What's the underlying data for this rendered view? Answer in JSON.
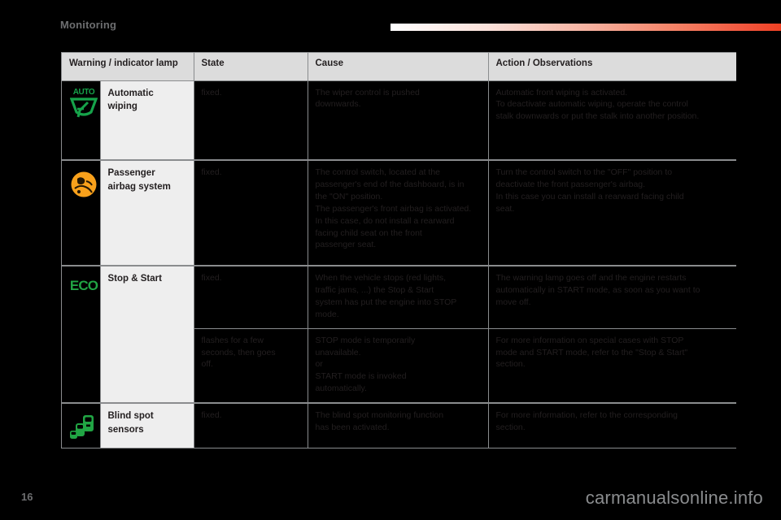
{
  "header": {
    "chapter": "Monitoring",
    "accent_color": "#ef4123"
  },
  "table": {
    "columns": [
      "Warning / indicator lamp",
      "State",
      "Cause",
      "Action / Observations"
    ],
    "rows": [
      {
        "icon": "auto-wiping-icon",
        "icon_text": "AUTO",
        "icon_color": "#16a34a",
        "label": "Automatic\nwiping",
        "state": "fixed.",
        "cause": "The wiper control is pushed\ndownwards.",
        "action": "Automatic front wiping is activated.\nTo deactivate automatic wiping, operate the control\nstalk downwards or put the stalk into another position."
      },
      {
        "icon": "passenger-airbag-icon",
        "icon_text": "",
        "icon_color": "#f9a11b",
        "label": "Passenger\nairbag system",
        "state": "fixed.",
        "cause": "The control switch, located at the\npassenger's end of the dashboard, is in\nthe \"ON\" position.\nThe passenger's front airbag is activated.\nIn this case, do not install a rearward\nfacing child seat on the front\npassenger seat.",
        "action": "Turn the control switch to the \"OFF\" position to\ndeactivate the front passenger's airbag.\nIn this case you can install a rearward facing child\nseat."
      },
      {
        "icon": "eco-icon",
        "icon_text": "ECO",
        "icon_color": "#21a544",
        "label": "Stop & Start",
        "state": "fixed.",
        "cause": "When the vehicle stops (red lights,\ntraffic jams, ...) the Stop & Start\nsystem has put the engine into STOP\nmode.",
        "action": "The warning lamp goes off and the engine restarts\nautomatically in START mode, as soon as you want to\nmove off.",
        "sub": {
          "state": "flashes for a few\nseconds, then goes\noff.",
          "cause": "STOP mode is temporarily\nunavailable.\nor\nSTART mode is invoked\nautomatically.",
          "action": "For more information on special cases with STOP\nmode and START mode, refer to the \"Stop & Start\"\nsection."
        }
      },
      {
        "icon": "blind-spot-icon",
        "icon_text": "",
        "icon_color": "#21a544",
        "label": "Blind spot\nsensors",
        "state": "fixed.",
        "cause": "The blind spot monitoring function\nhas been activated.",
        "action": "For more information, refer to the corresponding\nsection."
      }
    ]
  },
  "footer": {
    "page_number": "16",
    "watermark": "carmanualsonline.info"
  }
}
